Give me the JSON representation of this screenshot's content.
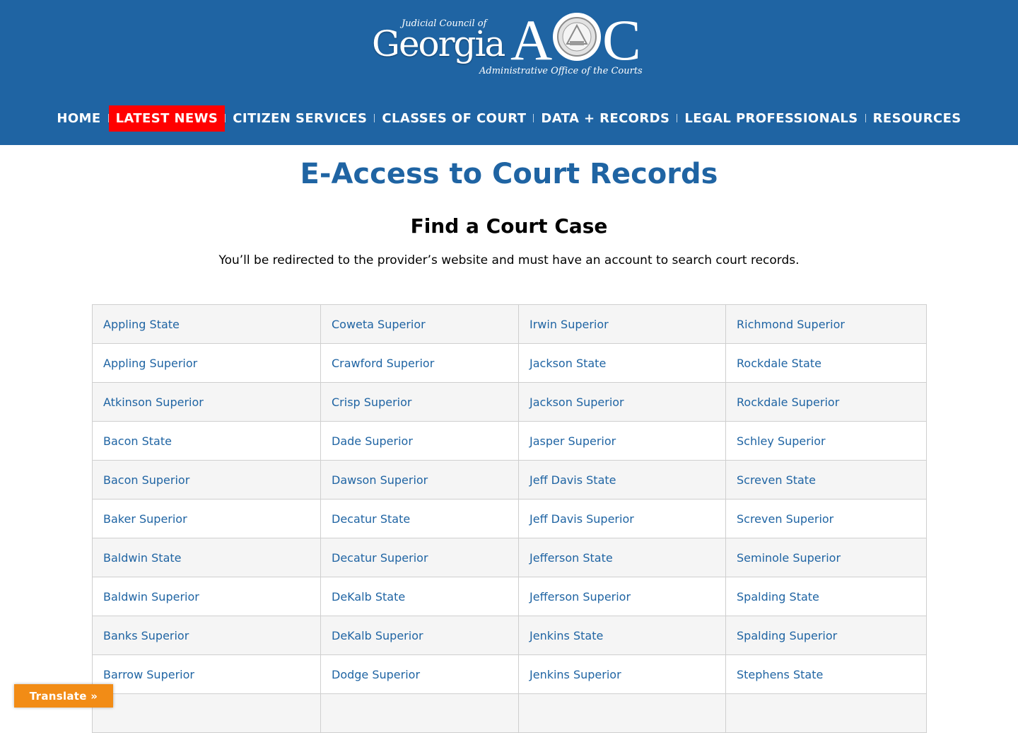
{
  "logo": {
    "top_text": "Judicial Council of",
    "state": "Georgia",
    "acronym_a": "A",
    "acronym_c": "C",
    "subtitle": "Administrative Office of the Courts"
  },
  "nav": [
    {
      "label": "HOME",
      "active": false
    },
    {
      "label": "LATEST NEWS",
      "active": true
    },
    {
      "label": "CITIZEN SERVICES",
      "active": false
    },
    {
      "label": "CLASSES OF COURT",
      "active": false
    },
    {
      "label": "DATA + RECORDS",
      "active": false
    },
    {
      "label": "LEGAL PROFESSIONALS",
      "active": false
    },
    {
      "label": "RESOURCES",
      "active": false
    }
  ],
  "page": {
    "title": "E-Access to Court Records",
    "section_title": "Find a Court Case",
    "intro": "You’ll be redirected to the provider’s website and must have an account to search court records."
  },
  "courts_table": [
    [
      "Appling State",
      "Coweta Superior",
      "Irwin Superior",
      "Richmond Superior"
    ],
    [
      "Appling Superior",
      "Crawford Superior",
      "Jackson State",
      "Rockdale State"
    ],
    [
      "Atkinson Superior",
      "Crisp Superior",
      "Jackson Superior",
      "Rockdale Superior"
    ],
    [
      "Bacon State",
      "Dade Superior",
      "Jasper Superior",
      "Schley Superior"
    ],
    [
      "Bacon Superior",
      "Dawson Superior",
      "Jeff Davis State",
      "Screven State"
    ],
    [
      "Baker Superior",
      "Decatur State",
      "Jeff Davis Superior",
      "Screven Superior"
    ],
    [
      "Baldwin State",
      "Decatur Superior",
      "Jefferson State",
      "Seminole Superior"
    ],
    [
      "Baldwin Superior",
      "DeKalb State",
      "Jefferson Superior",
      "Spalding State"
    ],
    [
      "Banks Superior",
      "DeKalb Superior",
      "Jenkins State",
      "Spalding Superior"
    ],
    [
      "Barrow Superior",
      "Dodge Superior",
      "Jenkins Superior",
      "Stephens State"
    ],
    [
      "",
      "",
      "",
      ""
    ]
  ],
  "translate_button": "Translate »",
  "colors": {
    "header_bg": "#1f64a3",
    "active_nav_bg": "#ff0000",
    "link": "#1f64a3",
    "translate_bg": "#f28c16"
  }
}
